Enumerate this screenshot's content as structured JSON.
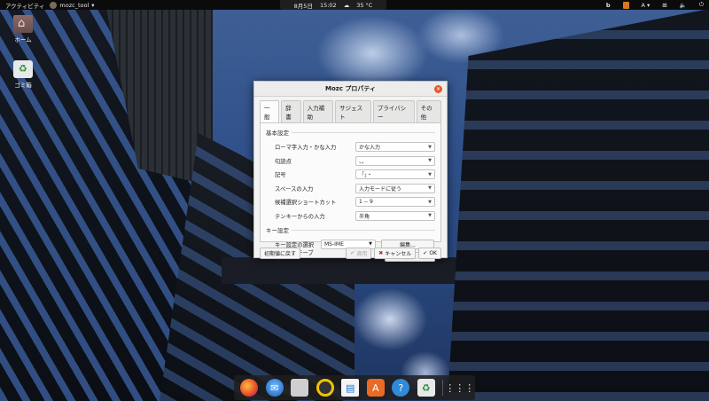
{
  "topbar": {
    "activities": "アクティビティ",
    "app_name": "mozc_tool",
    "app_arrow": "▾",
    "date": "8月5日",
    "time": "15:02",
    "weather_icon": "cloud-icon",
    "temperature": "35 °C",
    "tray_b": "b",
    "input_indicator": "A"
  },
  "desktop": {
    "home_label": "ホーム",
    "trash_label": "ゴミ箱"
  },
  "dialog": {
    "title": "Mozc プロパティ",
    "tabs": [
      "一般",
      "辞書",
      "入力補助",
      "サジェスト",
      "プライバシー",
      "その他"
    ],
    "active_tab": "一般",
    "basic_section": "基本設定",
    "basic_rows": [
      {
        "label": "ローマ字入力・かな入力",
        "value": "かな入力"
      },
      {
        "label": "句読点",
        "value": "、。"
      },
      {
        "label": "記号",
        "value": "「」・"
      },
      {
        "label": "スペースの入力",
        "value": "入力モードに従う"
      },
      {
        "label": "候補選択ショートカット",
        "value": "1 -- 9"
      },
      {
        "label": "テンキーからの入力",
        "value": "半角"
      }
    ],
    "key_section": "キー設定",
    "keymap_label": "キー設定の選択",
    "keymap_value": "MS-IME",
    "keymap_edit": "編集...",
    "romaji_label": "ローマ字テーブル",
    "romaji_edit": "編集...",
    "reset_button": "初期値に戻す",
    "apply_button": "適用",
    "cancel_button": "キャンセル",
    "ok_button": "OK"
  },
  "dock": {
    "apps": [
      "firefox-icon",
      "thunderbird-icon",
      "files-icon",
      "rhythmbox-icon",
      "writer-icon",
      "software-icon",
      "help-icon",
      "trash-icon",
      "app-grid-icon"
    ]
  }
}
